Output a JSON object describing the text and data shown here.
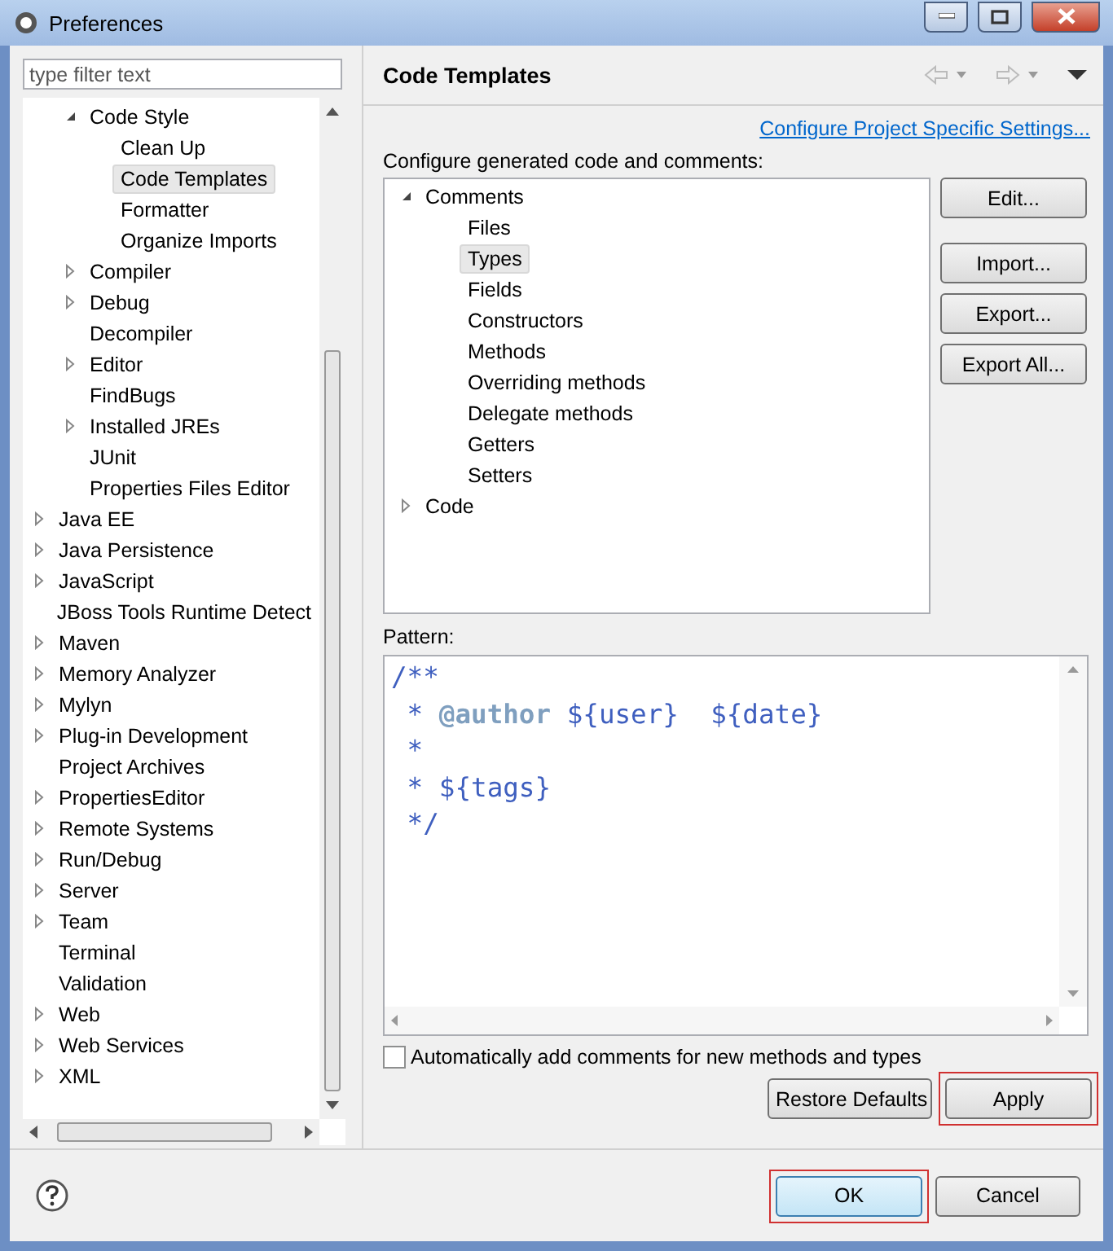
{
  "window": {
    "title": "Preferences"
  },
  "filter": {
    "placeholder": "type filter text"
  },
  "tree": {
    "nested_items": [
      {
        "label": "Code Style",
        "expanded": true,
        "selected": false,
        "children": [
          {
            "label": "Clean Up",
            "selected": false
          },
          {
            "label": "Code Templates",
            "selected": true
          },
          {
            "label": "Formatter",
            "selected": false
          },
          {
            "label": "Organize Imports",
            "selected": false
          }
        ]
      },
      {
        "label": "Compiler",
        "expanded": false,
        "selected": false
      },
      {
        "label": "Debug",
        "expanded": false,
        "selected": false
      },
      {
        "label": "Decompiler",
        "selected": false
      },
      {
        "label": "Editor",
        "expanded": false,
        "selected": false
      },
      {
        "label": "FindBugs",
        "selected": false
      },
      {
        "label": "Installed JREs",
        "expanded": false,
        "selected": false
      },
      {
        "label": "JUnit",
        "selected": false
      },
      {
        "label": "Properties Files Editor",
        "selected": false
      }
    ],
    "items": [
      {
        "label": "Java EE",
        "expanded": false,
        "selected": false
      },
      {
        "label": "Java Persistence",
        "expanded": false,
        "selected": false
      },
      {
        "label": "JavaScript",
        "expanded": false,
        "selected": false
      },
      {
        "label": "JBoss Tools Runtime Detect",
        "selected": false
      },
      {
        "label": "Maven",
        "expanded": false,
        "selected": false
      },
      {
        "label": "Memory Analyzer",
        "expanded": false,
        "selected": false
      },
      {
        "label": "Mylyn",
        "expanded": false,
        "selected": false
      },
      {
        "label": "Plug-in Development",
        "expanded": false,
        "selected": false
      },
      {
        "label": "Project Archives",
        "selected": false
      },
      {
        "label": "PropertiesEditor",
        "expanded": false,
        "selected": false
      },
      {
        "label": "Remote Systems",
        "expanded": false,
        "selected": false
      },
      {
        "label": "Run/Debug",
        "expanded": false,
        "selected": false
      },
      {
        "label": "Server",
        "expanded": false,
        "selected": false
      },
      {
        "label": "Team",
        "expanded": false,
        "selected": false
      },
      {
        "label": "Terminal",
        "selected": false
      },
      {
        "label": "Validation",
        "selected": false
      },
      {
        "label": "Web",
        "expanded": false,
        "selected": false
      },
      {
        "label": "Web Services",
        "expanded": false,
        "selected": false
      },
      {
        "label": "XML",
        "expanded": false,
        "selected": false
      }
    ]
  },
  "page": {
    "title": "Code Templates",
    "link": "Configure Project Specific Settings...",
    "description": "Configure generated code and comments:",
    "templates": [
      {
        "label": "Comments",
        "expanded": true,
        "selected": false,
        "children": [
          {
            "label": "Files",
            "selected": false
          },
          {
            "label": "Types",
            "selected": true
          },
          {
            "label": "Fields",
            "selected": false
          },
          {
            "label": "Constructors",
            "selected": false
          },
          {
            "label": "Methods",
            "selected": false
          },
          {
            "label": "Overriding methods",
            "selected": false
          },
          {
            "label": "Delegate methods",
            "selected": false
          },
          {
            "label": "Getters",
            "selected": false
          },
          {
            "label": "Setters",
            "selected": false
          }
        ]
      },
      {
        "label": "Code",
        "expanded": false,
        "selected": false
      }
    ],
    "side_buttons": [
      "Edit...",
      "Import...",
      "Export...",
      "Export All..."
    ],
    "pattern_label": "Pattern:",
    "pattern_lines": [
      "/**",
      " * **@author** ${user}  ${date}",
      " *",
      " * ${tags}",
      " */"
    ],
    "auto_comments": {
      "label": "Automatically add comments for new methods and types",
      "checked": false
    },
    "page_buttons": [
      {
        "label": "Restore Defaults",
        "highlighted": false
      },
      {
        "label": "Apply",
        "highlighted": true
      }
    ]
  },
  "dialog_buttons": [
    {
      "label": "OK",
      "default": true,
      "highlighted": true
    },
    {
      "label": "Cancel",
      "default": false,
      "highlighted": false
    }
  ]
}
